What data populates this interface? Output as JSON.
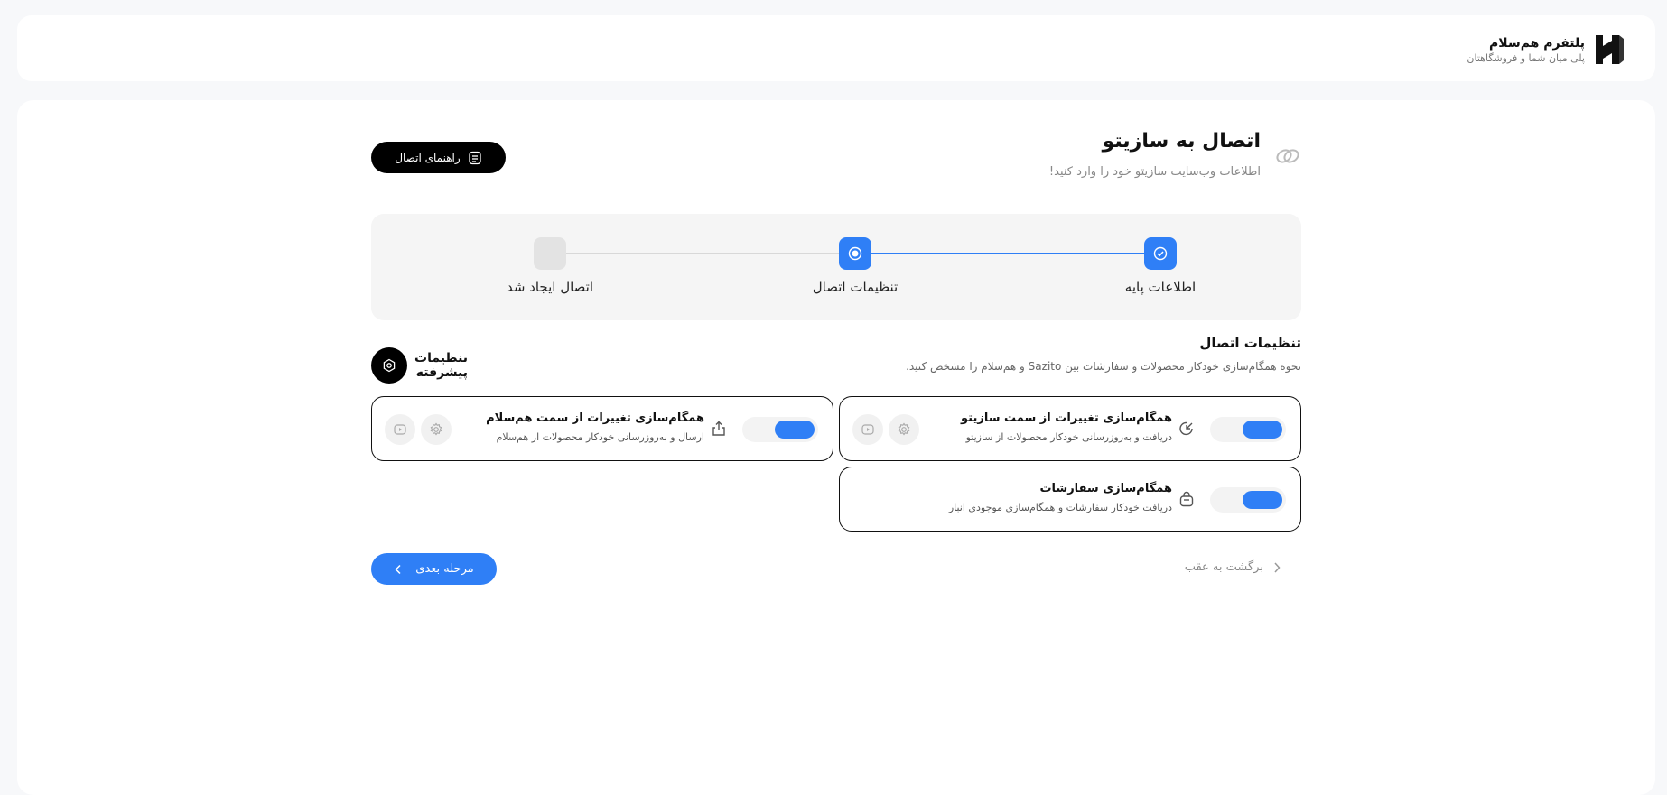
{
  "brand": {
    "title": "پلتفرم هم‌سلام",
    "subtitle": "پلی میان شما و فروشگاهتان"
  },
  "header": {
    "title": "اتصال به سازیتو",
    "subtitle": "اطلاعات وب‌سایت سازیتو خود را وارد کنید!",
    "guide_button": "راهنمای اتصال"
  },
  "steps": [
    {
      "label": "اطلاعات پایه",
      "state": "done"
    },
    {
      "label": "تنظیمات اتصال",
      "state": "active"
    },
    {
      "label": "اتصال ایجاد شد",
      "state": "todo"
    }
  ],
  "section": {
    "title": "تنظیمات اتصال",
    "subtitle": "نحوه همگام‌سازی خودکار محصولات و سفارشات بین Sazito و هم‌سلام را مشخص کنید.",
    "advanced_label_line1": "تنظیمات",
    "advanced_label_line2": "پیشرفته"
  },
  "cards": [
    {
      "title": "همگام‌سازی تغییرات از سمت سازیتو",
      "subtitle": "دریافت و به‌روزرسانی خودکار محصولات از سازیتو",
      "enabled": true,
      "icon": "arrow-in-icon"
    },
    {
      "title": "همگام‌سازی تغییرات از سمت هم‌سلام",
      "subtitle": "ارسال و به‌روزرسانی خودکار محصولات از هم‌سلام",
      "enabled": true,
      "icon": "upload-icon"
    },
    {
      "title": "همگام‌سازی سفارشات",
      "subtitle": "دریافت خودکار سفارشات و همگام‌سازی موجودی انبار",
      "enabled": true,
      "icon": "bag-icon"
    }
  ],
  "footer": {
    "next_button": "مرحله بعدی",
    "back_link": "برگشت به عقب"
  },
  "colors": {
    "accent": "#2f7ff6",
    "dark": "#000000",
    "card_border": "#111111"
  }
}
